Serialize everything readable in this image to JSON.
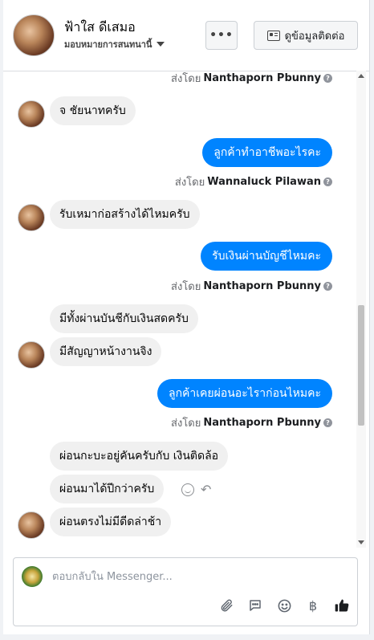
{
  "header": {
    "contact_name": "ฟ้าใส ดีเสมอ",
    "assign_label": "มอบหมายการสนทนานี้",
    "more_label": "•••",
    "view_contact_label": "ดูข้อมูลติดต่อ"
  },
  "messages": {
    "note_1": {
      "prefix": "ส่งโดย",
      "name": "Nanthaporn Pbunny"
    },
    "in_1": "จ ชัยนาทครับ",
    "out_1": "ลูกค้าทำอาชีพอะไรคะ",
    "note_2": {
      "prefix": "ส่งโดย",
      "name": "Wannaluck Pilawan"
    },
    "in_2": "รับเหมาก่อสร้างได้ไหมครับ",
    "out_2": "รับเงินผ่านบัญชีไหมคะ",
    "note_3": {
      "prefix": "ส่งโดย",
      "name": "Nanthaporn Pbunny"
    },
    "in_3": "มีทั้งผ่านบันชีกับเงินสดครับ",
    "in_4": "มีสัญญาหน้างานจิง",
    "out_3": "ลูกค้าเคยผ่อนอะไราก่อนไหมคะ",
    "note_4": {
      "prefix": "ส่งโดย",
      "name": "Nanthaporn Pbunny"
    },
    "in_5": "ผ่อนกะบะอยู่คันครับกับ เงินติดล้อ",
    "in_6": "ผ่อนมาได้ปีกว่าครับ",
    "in_7": "ผ่อนตรงไม่มีดีดล่าช้า"
  },
  "composer": {
    "placeholder": "ตอบกลับใน Messenger..."
  },
  "icons": {
    "attach": "paperclip-icon",
    "saved_replies": "chat-bubble-icon",
    "emoji": "smiley-icon",
    "payment": "baht-icon",
    "like": "thumbs-up-icon"
  },
  "colors": {
    "outgoing_bubble": "#0084ff",
    "incoming_bubble": "#f0f0f0",
    "like_icon": "#1c1e21"
  }
}
